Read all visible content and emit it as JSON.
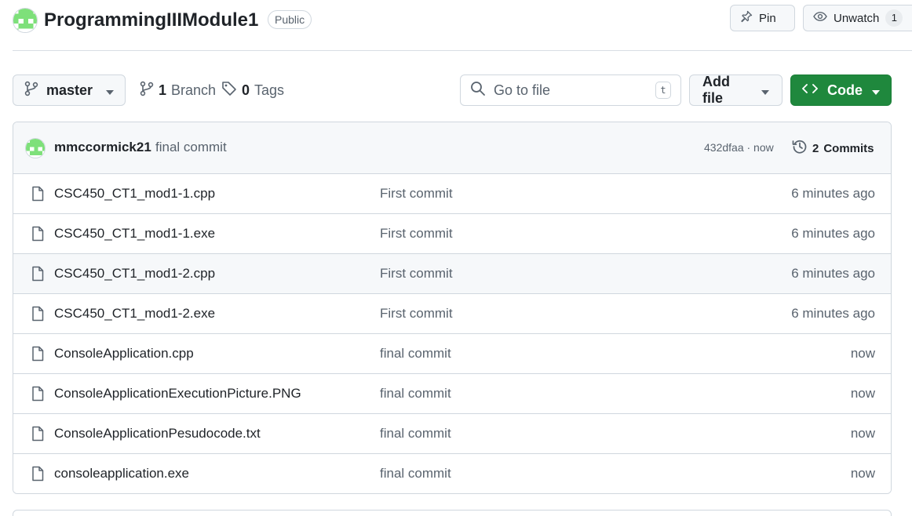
{
  "repo": {
    "name": "ProgrammingIIIModule1",
    "visibility": "Public",
    "pin_label": "Pin",
    "watch_label": "Unwatch",
    "watch_count": "1"
  },
  "toolbar": {
    "branch": "master",
    "branch_count": "1",
    "branch_label": "Branch",
    "tag_count": "0",
    "tag_label": "Tags",
    "goto_placeholder": "Go to file",
    "goto_shortcut": "t",
    "add_file_label": "Add file",
    "code_label": "Code"
  },
  "latest_commit": {
    "author": "mmccormick21",
    "message": "final commit",
    "sha_time": "432dfaa · now",
    "commits_count": "2",
    "commits_label": "Commits"
  },
  "files": [
    {
      "name": "CSC450_CT1_mod1-1.cpp",
      "message": "First commit",
      "age": "6 minutes ago"
    },
    {
      "name": "CSC450_CT1_mod1-1.exe",
      "message": "First commit",
      "age": "6 minutes ago"
    },
    {
      "name": "CSC450_CT1_mod1-2.cpp",
      "message": "First commit",
      "age": "6 minutes ago"
    },
    {
      "name": "CSC450_CT1_mod1-2.exe",
      "message": "First commit",
      "age": "6 minutes ago"
    },
    {
      "name": "ConsoleApplication.cpp",
      "message": "final commit",
      "age": "now"
    },
    {
      "name": "ConsoleApplicationExecutionPicture.PNG",
      "message": "final commit",
      "age": "now"
    },
    {
      "name": "ConsoleApplicationPesudocode.txt",
      "message": "final commit",
      "age": "now"
    },
    {
      "name": "consoleapplication.exe",
      "message": "final commit",
      "age": "now"
    }
  ],
  "colors": {
    "code_button": "#1f883d",
    "avatar_green": "#7ee07a",
    "border": "#d0d7de",
    "muted_text": "#59636e"
  },
  "icons": {
    "pin": "pin-icon",
    "watch": "eye-icon",
    "branch": "git-branch-icon",
    "tag": "tag-icon",
    "search": "search-icon",
    "code": "code-icon",
    "history": "history-icon",
    "file": "file-icon",
    "caret": "triangle-down-icon"
  }
}
